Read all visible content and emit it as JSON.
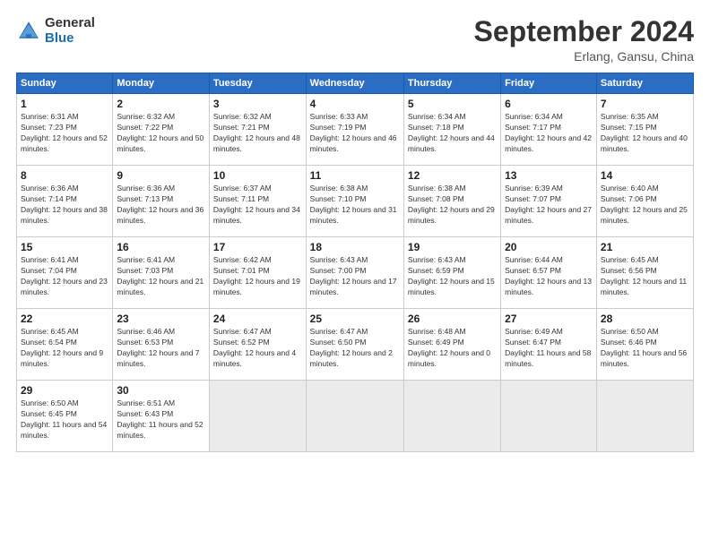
{
  "header": {
    "logo_general": "General",
    "logo_blue": "Blue",
    "title": "September 2024",
    "location": "Erlang, Gansu, China"
  },
  "days_of_week": [
    "Sunday",
    "Monday",
    "Tuesday",
    "Wednesday",
    "Thursday",
    "Friday",
    "Saturday"
  ],
  "weeks": [
    [
      {
        "day": "1",
        "sunrise": "6:31 AM",
        "sunset": "7:23 PM",
        "daylight": "12 hours and 52 minutes."
      },
      {
        "day": "2",
        "sunrise": "6:32 AM",
        "sunset": "7:22 PM",
        "daylight": "12 hours and 50 minutes."
      },
      {
        "day": "3",
        "sunrise": "6:32 AM",
        "sunset": "7:21 PM",
        "daylight": "12 hours and 48 minutes."
      },
      {
        "day": "4",
        "sunrise": "6:33 AM",
        "sunset": "7:19 PM",
        "daylight": "12 hours and 46 minutes."
      },
      {
        "day": "5",
        "sunrise": "6:34 AM",
        "sunset": "7:18 PM",
        "daylight": "12 hours and 44 minutes."
      },
      {
        "day": "6",
        "sunrise": "6:34 AM",
        "sunset": "7:17 PM",
        "daylight": "12 hours and 42 minutes."
      },
      {
        "day": "7",
        "sunrise": "6:35 AM",
        "sunset": "7:15 PM",
        "daylight": "12 hours and 40 minutes."
      }
    ],
    [
      {
        "day": "8",
        "sunrise": "6:36 AM",
        "sunset": "7:14 PM",
        "daylight": "12 hours and 38 minutes."
      },
      {
        "day": "9",
        "sunrise": "6:36 AM",
        "sunset": "7:13 PM",
        "daylight": "12 hours and 36 minutes."
      },
      {
        "day": "10",
        "sunrise": "6:37 AM",
        "sunset": "7:11 PM",
        "daylight": "12 hours and 34 minutes."
      },
      {
        "day": "11",
        "sunrise": "6:38 AM",
        "sunset": "7:10 PM",
        "daylight": "12 hours and 31 minutes."
      },
      {
        "day": "12",
        "sunrise": "6:38 AM",
        "sunset": "7:08 PM",
        "daylight": "12 hours and 29 minutes."
      },
      {
        "day": "13",
        "sunrise": "6:39 AM",
        "sunset": "7:07 PM",
        "daylight": "12 hours and 27 minutes."
      },
      {
        "day": "14",
        "sunrise": "6:40 AM",
        "sunset": "7:06 PM",
        "daylight": "12 hours and 25 minutes."
      }
    ],
    [
      {
        "day": "15",
        "sunrise": "6:41 AM",
        "sunset": "7:04 PM",
        "daylight": "12 hours and 23 minutes."
      },
      {
        "day": "16",
        "sunrise": "6:41 AM",
        "sunset": "7:03 PM",
        "daylight": "12 hours and 21 minutes."
      },
      {
        "day": "17",
        "sunrise": "6:42 AM",
        "sunset": "7:01 PM",
        "daylight": "12 hours and 19 minutes."
      },
      {
        "day": "18",
        "sunrise": "6:43 AM",
        "sunset": "7:00 PM",
        "daylight": "12 hours and 17 minutes."
      },
      {
        "day": "19",
        "sunrise": "6:43 AM",
        "sunset": "6:59 PM",
        "daylight": "12 hours and 15 minutes."
      },
      {
        "day": "20",
        "sunrise": "6:44 AM",
        "sunset": "6:57 PM",
        "daylight": "12 hours and 13 minutes."
      },
      {
        "day": "21",
        "sunrise": "6:45 AM",
        "sunset": "6:56 PM",
        "daylight": "12 hours and 11 minutes."
      }
    ],
    [
      {
        "day": "22",
        "sunrise": "6:45 AM",
        "sunset": "6:54 PM",
        "daylight": "12 hours and 9 minutes."
      },
      {
        "day": "23",
        "sunrise": "6:46 AM",
        "sunset": "6:53 PM",
        "daylight": "12 hours and 7 minutes."
      },
      {
        "day": "24",
        "sunrise": "6:47 AM",
        "sunset": "6:52 PM",
        "daylight": "12 hours and 4 minutes."
      },
      {
        "day": "25",
        "sunrise": "6:47 AM",
        "sunset": "6:50 PM",
        "daylight": "12 hours and 2 minutes."
      },
      {
        "day": "26",
        "sunrise": "6:48 AM",
        "sunset": "6:49 PM",
        "daylight": "12 hours and 0 minutes."
      },
      {
        "day": "27",
        "sunrise": "6:49 AM",
        "sunset": "6:47 PM",
        "daylight": "11 hours and 58 minutes."
      },
      {
        "day": "28",
        "sunrise": "6:50 AM",
        "sunset": "6:46 PM",
        "daylight": "11 hours and 56 minutes."
      }
    ],
    [
      {
        "day": "29",
        "sunrise": "6:50 AM",
        "sunset": "6:45 PM",
        "daylight": "11 hours and 54 minutes."
      },
      {
        "day": "30",
        "sunrise": "6:51 AM",
        "sunset": "6:43 PM",
        "daylight": "11 hours and 52 minutes."
      },
      null,
      null,
      null,
      null,
      null
    ]
  ]
}
